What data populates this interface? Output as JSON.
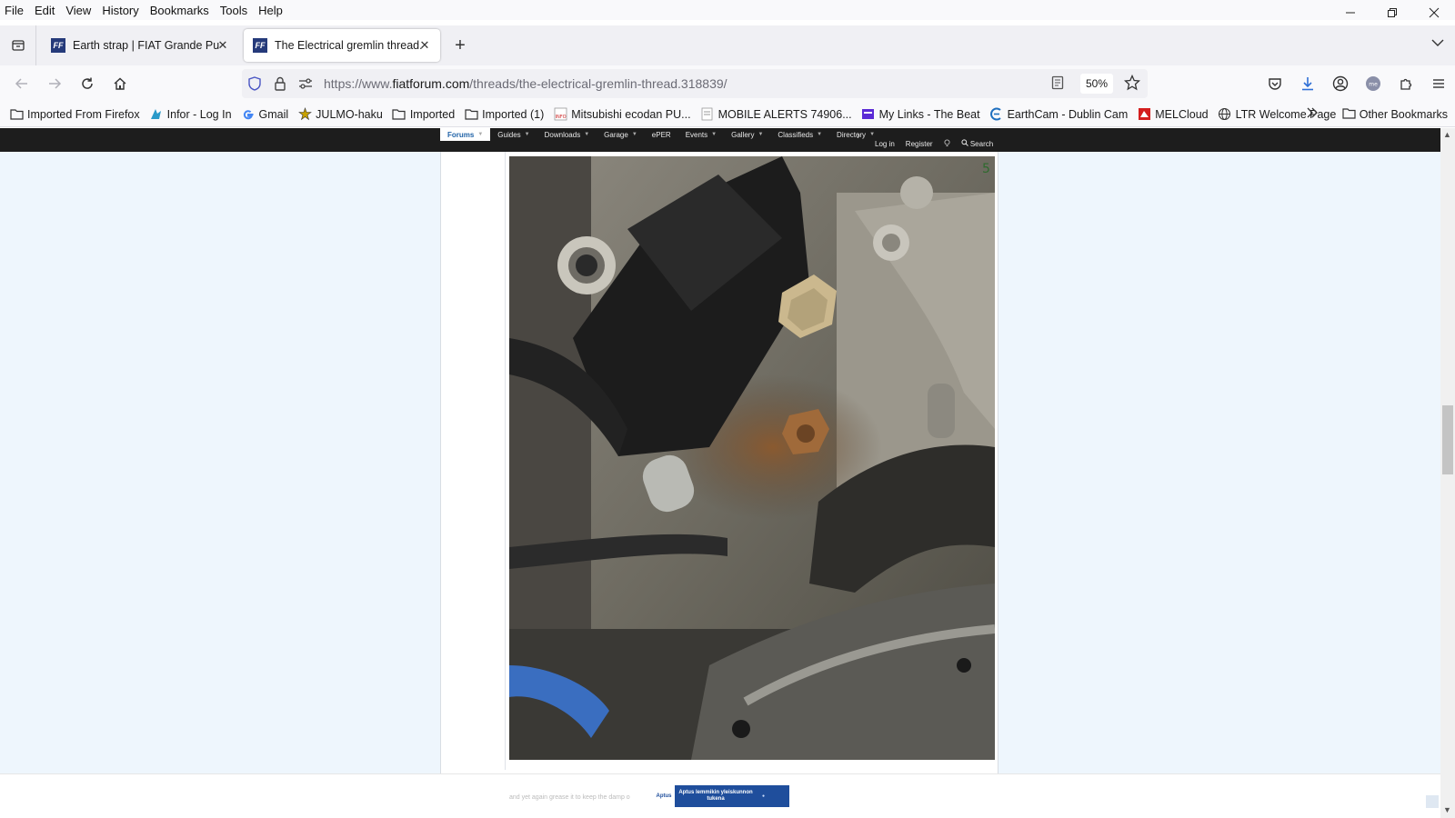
{
  "menubar": {
    "items": [
      "File",
      "Edit",
      "View",
      "History",
      "Bookmarks",
      "Tools",
      "Help"
    ]
  },
  "tabs": [
    {
      "title": "Earth strap | FIAT Grande Punto",
      "favicon": "FF",
      "active": false
    },
    {
      "title": "The Electrical gremlin thread....",
      "favicon": "FF",
      "active": true
    }
  ],
  "navbar": {
    "url_prefix": "https://www.",
    "url_host": "fiatforum.com",
    "url_path": "/threads/the-electrical-gremlin-thread.318839/",
    "zoom": "50%"
  },
  "bookmarks": [
    {
      "label": "Imported From Firefox",
      "icon": "folder-icon"
    },
    {
      "label": "Infor - Log In",
      "icon": "infor-icon"
    },
    {
      "label": "Gmail",
      "icon": "google-icon"
    },
    {
      "label": "JULMO-haku",
      "icon": "julmo-icon"
    },
    {
      "label": "Imported",
      "icon": "folder-icon"
    },
    {
      "label": "Imported (1)",
      "icon": "folder-icon"
    },
    {
      "label": "Mitsubishi ecodan PU...",
      "icon": "info-icon"
    },
    {
      "label": "MOBILE ALERTS  74906...",
      "icon": "page-icon"
    },
    {
      "label": "My Links - The Beat",
      "icon": "beat-icon"
    },
    {
      "label": "EarthCam - Dublin Cam",
      "icon": "earthcam-icon"
    },
    {
      "label": "MELCloud",
      "icon": "melcloud-icon"
    },
    {
      "label": "LTR Welcome Page",
      "icon": "globe-icon"
    }
  ],
  "bookmarks_other": "Other Bookmarks",
  "site": {
    "nav_tabs": [
      {
        "label": "Forums",
        "active": true
      },
      {
        "label": "Guides",
        "active": false
      },
      {
        "label": "Downloads",
        "active": false
      },
      {
        "label": "Garage",
        "active": false
      },
      {
        "label": "ePER",
        "active": false
      },
      {
        "label": "Events",
        "active": false
      },
      {
        "label": "Gallery",
        "active": false
      },
      {
        "label": "Classifieds",
        "active": false
      },
      {
        "label": "Directory",
        "active": false
      }
    ],
    "login": "Log in",
    "register": "Register",
    "search": "Search",
    "caption": "and yet again grease it to keep the damp o",
    "ad_text": "Aptus lemmikin yleiskunnon tukena",
    "ad_logo": "Aptus"
  },
  "colors": {
    "page_bg": "#eef6fd",
    "site_nav_bg": "#1d1d1d",
    "active_tab_text": "#2264a8",
    "ad_bg": "#1f4e9c"
  }
}
